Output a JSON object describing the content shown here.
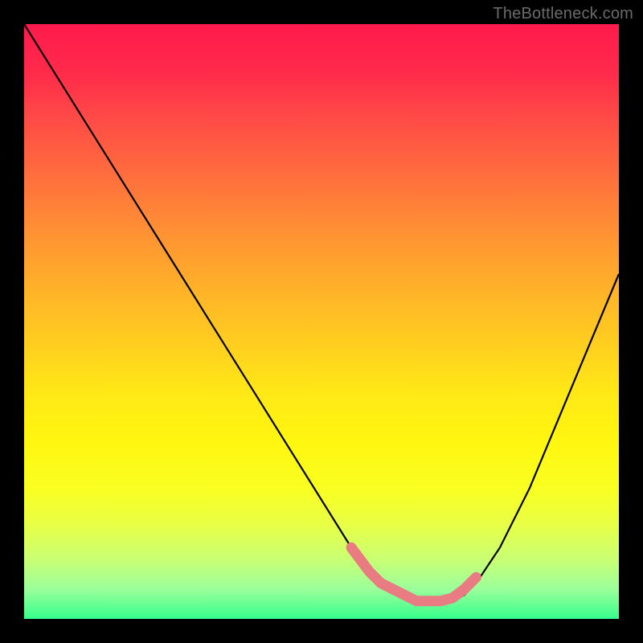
{
  "watermark": "TheBottleneck.com",
  "chart_data": {
    "type": "line",
    "title": "",
    "xlabel": "",
    "ylabel": "",
    "xlim": [
      0,
      100
    ],
    "ylim": [
      0,
      100
    ],
    "grid": false,
    "series": [
      {
        "name": "bottleneck-curve",
        "x": [
          0,
          5,
          10,
          15,
          20,
          25,
          30,
          35,
          40,
          45,
          50,
          55,
          58,
          60,
          63,
          65,
          68,
          70,
          72,
          74,
          76,
          80,
          85,
          90,
          95,
          100
        ],
        "values": [
          100,
          92,
          84,
          76,
          68,
          60,
          52,
          44,
          36,
          28,
          20,
          12,
          8,
          6,
          4,
          3,
          2.5,
          2.5,
          3,
          4,
          6,
          12,
          22,
          34,
          46,
          58
        ]
      },
      {
        "name": "highlight-band",
        "x": [
          55,
          58,
          60,
          62,
          64,
          66,
          68,
          70,
          72,
          74,
          76
        ],
        "values": [
          12,
          8,
          6,
          5,
          4,
          3,
          3,
          3,
          3.5,
          5,
          7
        ]
      }
    ],
    "gradient_stops": [
      {
        "pos": 0,
        "color": "#ff1a4d"
      },
      {
        "pos": 50,
        "color": "#ffd21e"
      },
      {
        "pos": 100,
        "color": "#36ff8c"
      }
    ]
  }
}
